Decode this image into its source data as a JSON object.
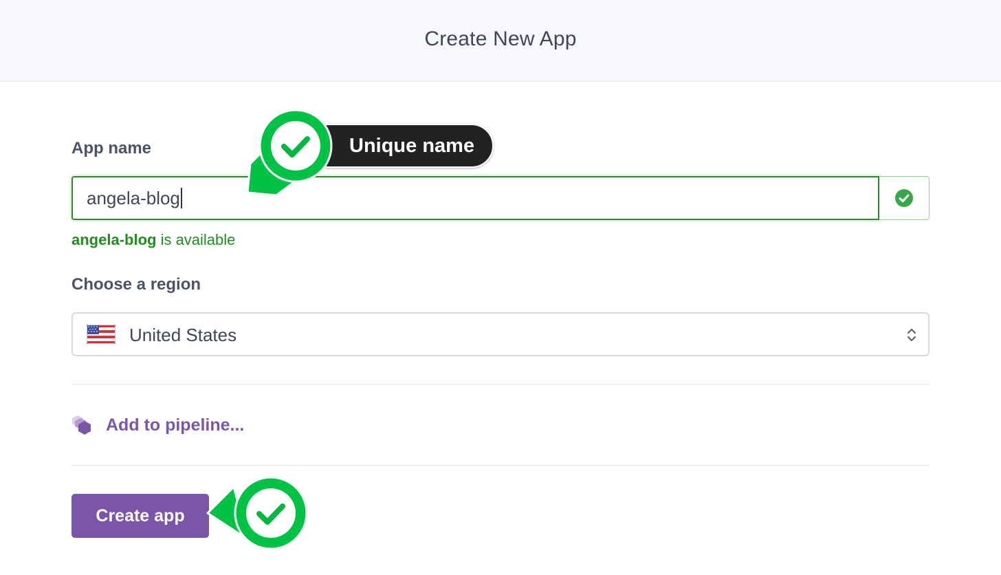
{
  "header": {
    "title": "Create New App"
  },
  "form": {
    "app_name_label": "App name",
    "app_name_value": "angela-blog",
    "availability": {
      "name": "angela-blog",
      "suffix": " is available"
    },
    "region_label": "Choose a region",
    "region_value": "United States",
    "pipeline_link": "Add to pipeline...",
    "create_button": "Create app"
  },
  "annotations": {
    "tooltip": "Unique name"
  },
  "colors": {
    "accent": "#7b55a7",
    "success": "#1f8d1f",
    "annotation_green": "#00c244",
    "tooltip_bg": "#222222"
  },
  "icons": {
    "input_status": "check-circle-icon",
    "region_flag": "us-flag-icon",
    "select_arrows": "chevron-up-down-icon",
    "pipeline": "hexagon-stack-icon",
    "annotation": "checkmark-pin-icon"
  }
}
